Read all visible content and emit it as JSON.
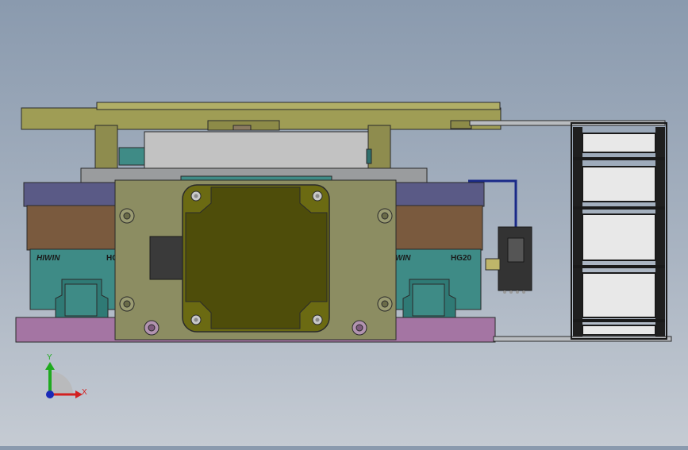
{
  "rail_labels": {
    "brand_left": "HIWIN",
    "model_left": "HG",
    "brand_right": "WIN",
    "model_right": "HG20"
  },
  "triad": {
    "y_axis": "Y",
    "x_axis": "X"
  },
  "colors": {
    "top_plate": "#9f9d55",
    "carriage_plate": "#5a5a86",
    "brown_block": "#7a5a3e",
    "rail_block": "#3e8b86",
    "base_plate": "#a475a3",
    "motor_mount": "#8c8d62",
    "motor_body": "#6b6a12",
    "motor_face": "#4e4d0a",
    "sensor_cable": "#1a2a88",
    "outline": "#2a2a2a"
  },
  "icons": [
    "coordinate-triad-icon"
  ]
}
